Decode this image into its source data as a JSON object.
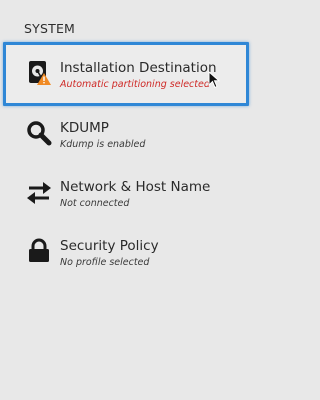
{
  "section": {
    "title": "SYSTEM"
  },
  "spokes": [
    {
      "title": "Installation Destination",
      "status": "Automatic partitioning selected",
      "icon": "hard-disk-warning-icon",
      "status_color": "#cf2a27",
      "selected": true
    },
    {
      "title": "KDUMP",
      "status": "Kdump is enabled",
      "icon": "magnifier-icon"
    },
    {
      "title": "Network & Host Name",
      "status": "Not connected",
      "icon": "network-arrows-icon"
    },
    {
      "title": "Security Policy",
      "status": "No profile selected",
      "icon": "padlock-icon"
    }
  ],
  "colors": {
    "background": "#e8e8e8",
    "selection_border": "#2f87d6",
    "warning_text": "#cf2a27",
    "warning_badge": "#f08a24"
  }
}
